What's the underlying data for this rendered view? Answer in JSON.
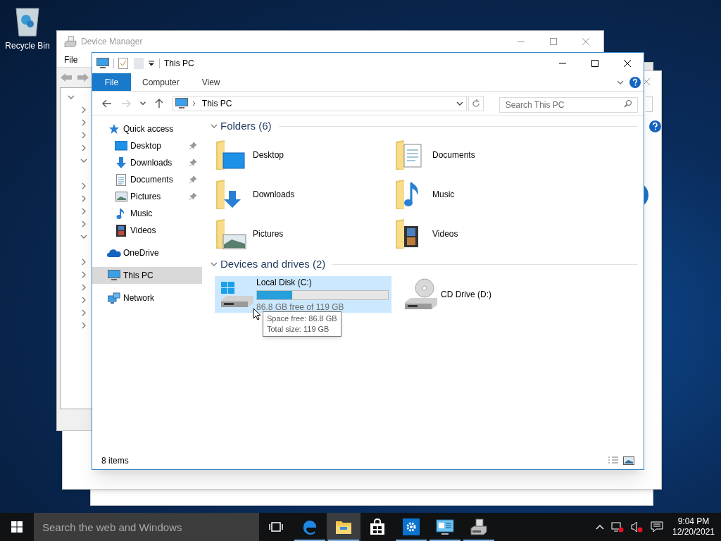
{
  "desktop": {
    "icons": [
      {
        "label": "Recycle Bin"
      }
    ]
  },
  "device_manager": {
    "title": "Device Manager",
    "menu": [
      "File"
    ],
    "tree": [
      {
        "expanded": true,
        "children": [
          {
            "expanded": false
          },
          {
            "expanded": false
          },
          {
            "expanded": false
          },
          {
            "expanded": false
          },
          {
            "expanded": true
          },
          {
            "expanded": false
          },
          {
            "expanded": false
          },
          {
            "expanded": false
          },
          {
            "expanded": false
          },
          {
            "expanded": true
          },
          {
            "expanded": false
          },
          {
            "expanded": false
          },
          {
            "expanded": false
          },
          {
            "expanded": false
          },
          {
            "expanded": false
          },
          {
            "expanded": false
          }
        ]
      }
    ]
  },
  "explorer": {
    "title": "This PC",
    "ribbon_tabs": [
      {
        "label": "File",
        "selected": true
      },
      {
        "label": "Computer",
        "selected": false
      },
      {
        "label": "View",
        "selected": false
      }
    ],
    "nav_buttons": [
      {
        "kind": "back",
        "disabled": false
      },
      {
        "kind": "forward",
        "disabled": true
      },
      {
        "kind": "recent",
        "disabled": false
      },
      {
        "kind": "up",
        "disabled": false
      }
    ],
    "address": "This PC",
    "search": {
      "placeholder": "Search This PC"
    },
    "nav": [
      {
        "label": "Quick access",
        "kind": "star",
        "selected": false,
        "children": [
          {
            "label": "Desktop",
            "kind": "desktop",
            "pinned": true,
            "selected": false
          },
          {
            "label": "Downloads",
            "kind": "download",
            "pinned": true,
            "selected": false
          },
          {
            "label": "Documents",
            "kind": "document",
            "pinned": true,
            "selected": false
          },
          {
            "label": "Pictures",
            "kind": "picture",
            "pinned": true,
            "selected": false
          },
          {
            "label": "Music",
            "kind": "music",
            "pinned": false,
            "selected": false
          },
          {
            "label": "Videos",
            "kind": "video",
            "pinned": false,
            "selected": false
          }
        ]
      },
      {
        "label": "OneDrive",
        "kind": "cloud",
        "selected": false
      },
      {
        "label": "This PC",
        "kind": "pc",
        "selected": true
      },
      {
        "label": "Network",
        "kind": "network",
        "selected": false
      }
    ],
    "groups": [
      {
        "title": "Folders (6)",
        "expanded": true,
        "items": [
          {
            "label": "Desktop",
            "kind": "desktop"
          },
          {
            "label": "Documents",
            "kind": "document"
          },
          {
            "label": "Downloads",
            "kind": "download"
          },
          {
            "label": "Music",
            "kind": "music"
          },
          {
            "label": "Pictures",
            "kind": "picture"
          },
          {
            "label": "Videos",
            "kind": "video"
          }
        ]
      },
      {
        "title": "Devices and drives (2)",
        "expanded": true,
        "items": [
          {
            "label": "Local Disk (C:)",
            "kind": "disk",
            "level": 0.27,
            "free": "86.8 GB free of 119 GB",
            "selected": true
          },
          {
            "label": "CD Drive (D:)",
            "kind": "cd",
            "selected": false
          }
        ]
      }
    ],
    "tooltip": [
      "Space free: 86.8 GB",
      "Total size: 119 GB"
    ],
    "status": "8 items"
  },
  "taskbar": {
    "search": {
      "placeholder": "Search the web and Windows"
    },
    "apps": [
      {
        "kind": "edge",
        "running": true,
        "selected": false
      },
      {
        "kind": "explorer",
        "running": true,
        "selected": true
      },
      {
        "kind": "store",
        "running": false,
        "selected": false
      },
      {
        "kind": "settings",
        "running": true,
        "selected": false
      },
      {
        "kind": "control-panel",
        "running": true,
        "selected": false
      },
      {
        "kind": "device-manager",
        "running": true,
        "selected": false
      }
    ],
    "time": "9:04 PM",
    "date": "12/20/2021"
  }
}
